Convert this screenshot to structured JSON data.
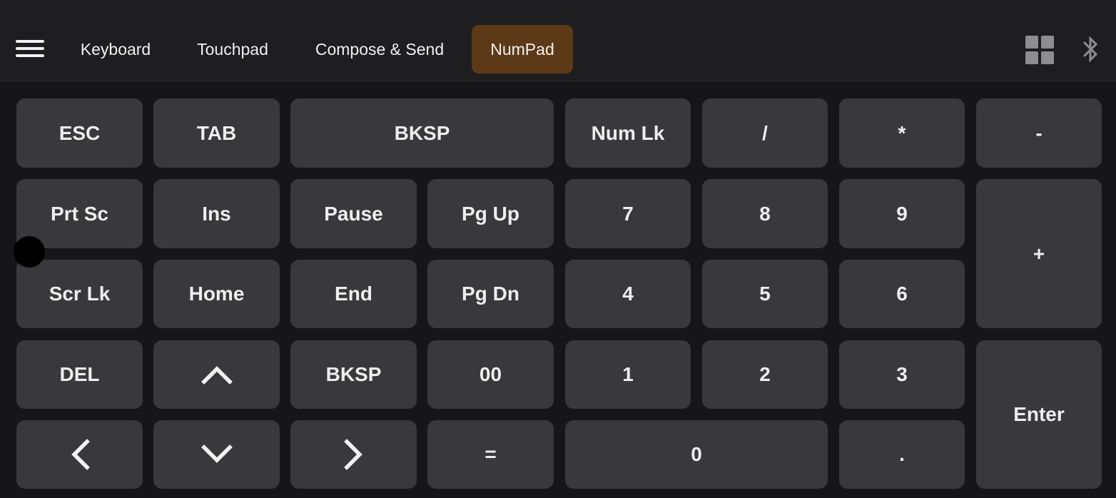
{
  "header": {
    "tabs": [
      {
        "label": "Keyboard",
        "active": false
      },
      {
        "label": "Touchpad",
        "active": false
      },
      {
        "label": "Compose & Send",
        "active": false
      },
      {
        "label": "NumPad",
        "active": true
      }
    ],
    "icons": {
      "menu": "hamburger-menu-icon",
      "layout": "grid-layout-icon",
      "bluetooth": "bluetooth-icon"
    }
  },
  "keys": {
    "esc": "ESC",
    "tab": "TAB",
    "bksp_top": "BKSP",
    "num_lk": "Num Lk",
    "slash": "/",
    "asterisk": "*",
    "minus": "-",
    "prt_sc": "Prt Sc",
    "ins": "Ins",
    "pause": "Pause",
    "pg_up": "Pg Up",
    "seven": "7",
    "eight": "8",
    "nine": "9",
    "plus": "+",
    "scr_lk": "Scr Lk",
    "home": "Home",
    "end": "End",
    "pg_dn": "Pg Dn",
    "four": "4",
    "five": "5",
    "six": "6",
    "del": "DEL",
    "bksp_mid": "BKSP",
    "double_zero": "00",
    "one": "1",
    "two": "2",
    "three": "3",
    "enter": "Enter",
    "equals": "=",
    "zero": "0",
    "dot": "."
  },
  "arrow_icons": {
    "up": "chevron-up-icon",
    "down": "chevron-down-icon",
    "left": "chevron-left-icon",
    "right": "chevron-right-icon"
  },
  "colors": {
    "active_tab": "#5d3a17",
    "key_background": "#39393d",
    "app_background": "#161618",
    "header_background": "#1e1e21"
  }
}
